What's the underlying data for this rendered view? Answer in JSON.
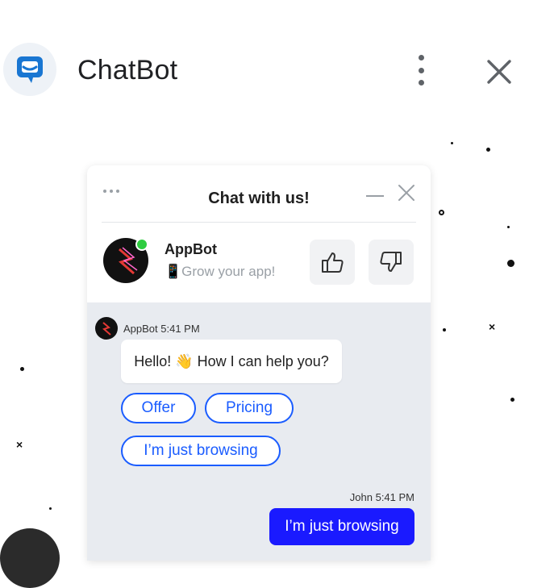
{
  "app": {
    "title": "ChatBot",
    "icons": {
      "logo": "chatbot-logo-icon",
      "menu": "more-vert-icon",
      "close": "close-icon"
    }
  },
  "widget": {
    "title": "Chat with us!",
    "bot": {
      "name": "AppBot",
      "tagline": "📱Grow your app!"
    },
    "rating": {
      "up_icon": "thumbs-up-icon",
      "down_icon": "thumbs-down-icon"
    },
    "messages": [
      {
        "sender_meta": "AppBot 5:41 PM",
        "text": "Hello! 👋 How I can help you?"
      }
    ],
    "quick_replies": [
      "Offer",
      "Pricing",
      "I’m just browsing"
    ],
    "user_message": {
      "meta": "John 5:41 PM",
      "text": "I’m just browsing"
    }
  },
  "colors": {
    "accent": "#1a5cff",
    "user_bubble": "#1a1aff",
    "logo": "#1976d2",
    "online": "#2ecc40"
  }
}
